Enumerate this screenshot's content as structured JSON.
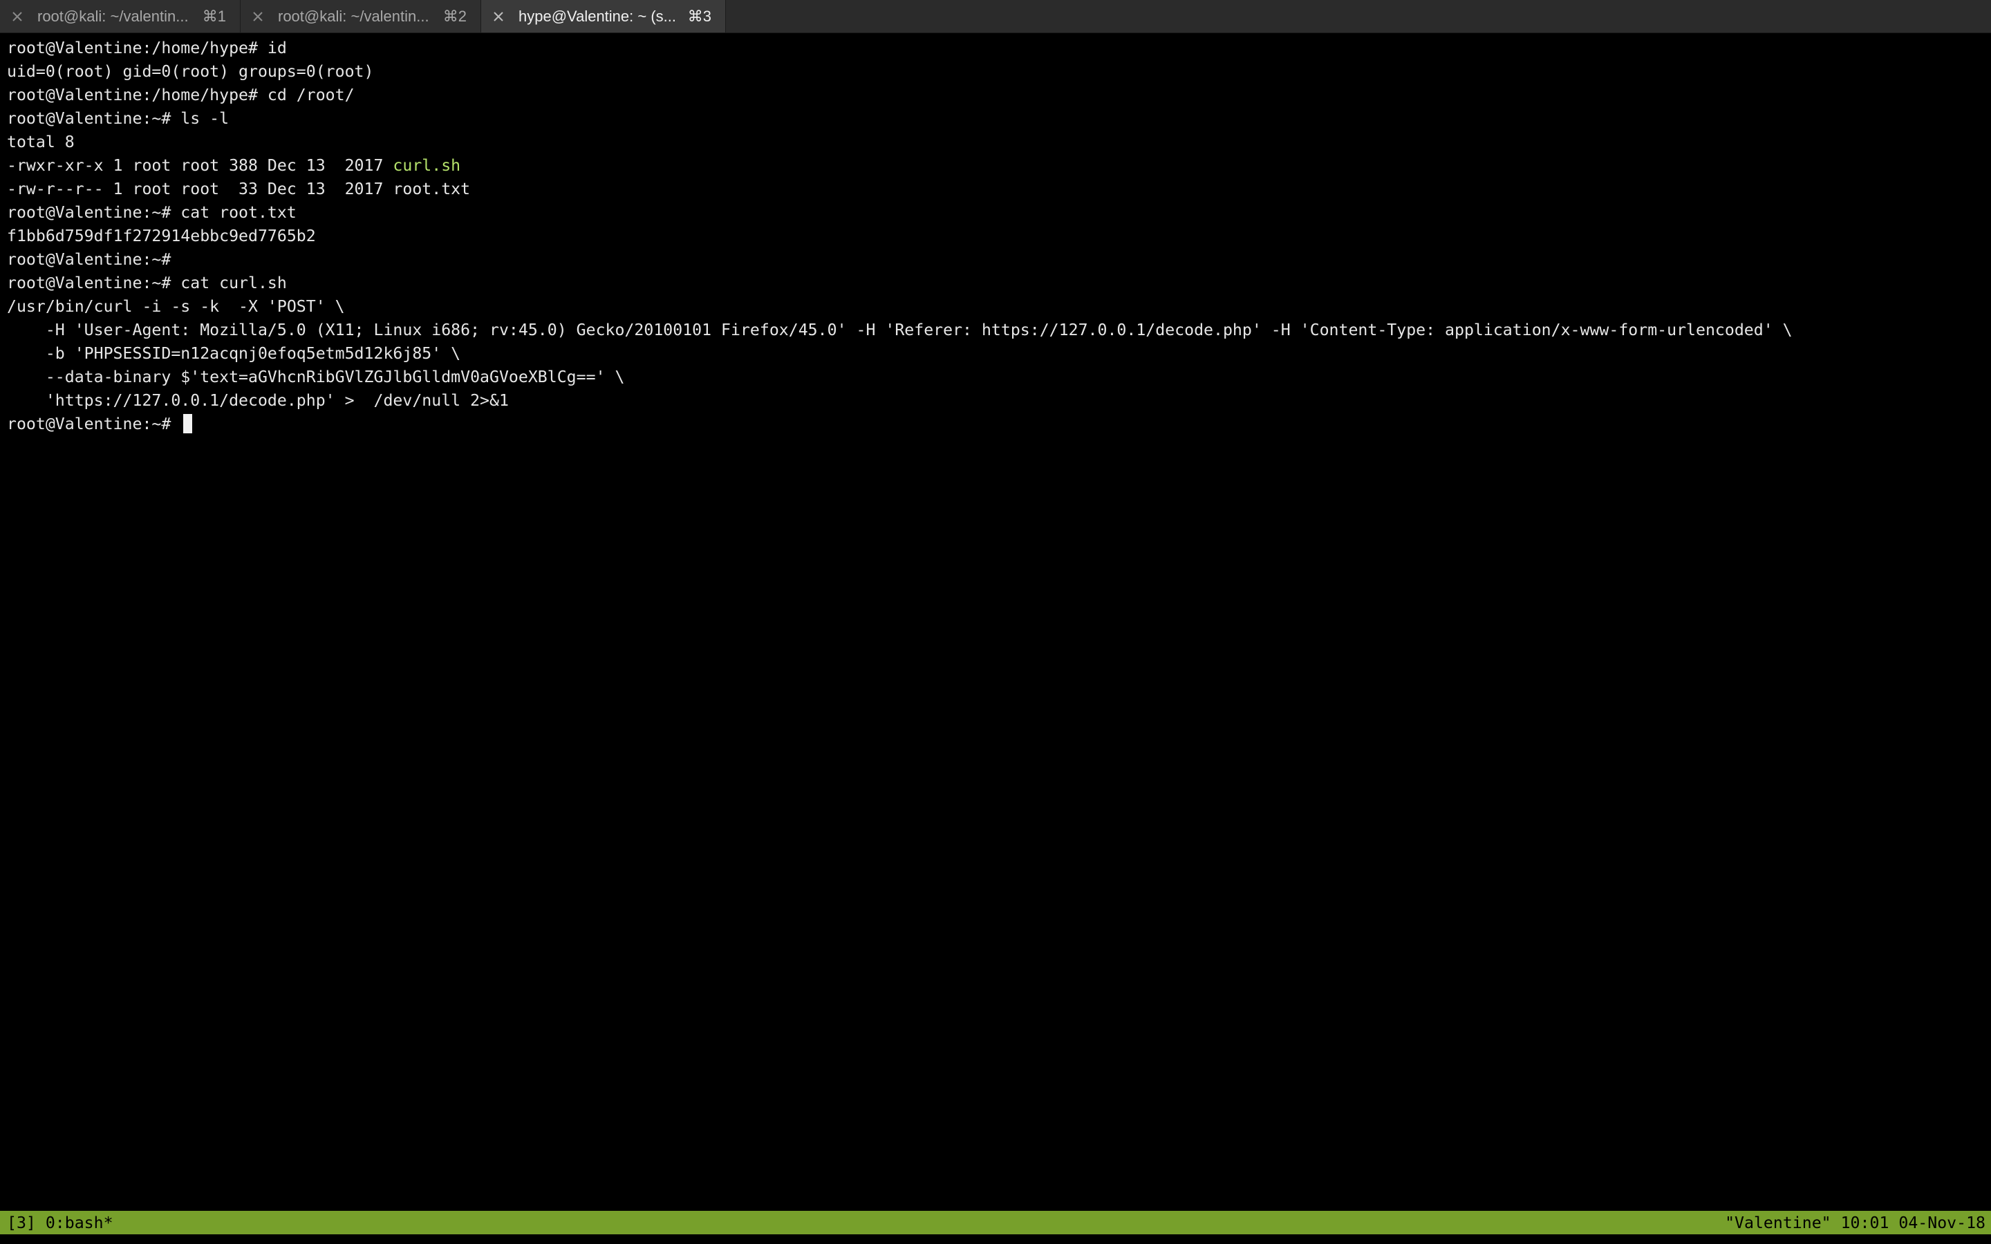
{
  "tabs": [
    {
      "label": "root@kali: ~/valentin...",
      "shortcut": "⌘1",
      "active": false
    },
    {
      "label": "root@kali: ~/valentin...",
      "shortcut": "⌘2",
      "active": false
    },
    {
      "label": "hype@Valentine: ~ (s...",
      "shortcut": "⌘3",
      "active": true
    }
  ],
  "terminal": {
    "lines": [
      "root@Valentine:/home/hype# id",
      "uid=0(root) gid=0(root) groups=0(root)",
      "root@Valentine:/home/hype# cd /root/",
      "root@Valentine:~# ls -l",
      "total 8",
      "-rwxr-xr-x 1 root root 388 Dec 13  2017 ",
      "curl.sh",
      "-rw-r--r-- 1 root root  33 Dec 13  2017 root.txt",
      "root@Valentine:~# cat root.txt",
      "f1bb6d759df1f272914ebbc9ed7765b2",
      "root@Valentine:~#",
      "root@Valentine:~# cat curl.sh",
      "/usr/bin/curl -i -s -k  -X 'POST' \\",
      "    -H 'User-Agent: Mozilla/5.0 (X11; Linux i686; rv:45.0) Gecko/20100101 Firefox/45.0' -H 'Referer: https://127.0.0.1/decode.php' -H 'Content-Type: application/x-www-form-urlencoded' \\",
      "    -b 'PHPSESSID=n12acqnj0efoq5etm5d12k6j85' \\",
      "    --data-binary $'text=aGVhcnRibGVlZGJlbGlldmV0aGVoeXBlCg==' \\",
      "    'https://127.0.0.1/decode.php' >  /dev/null 2>&1",
      "root@Valentine:~# "
    ]
  },
  "status": {
    "left": "[3] 0:bash*",
    "right": "\"Valentine\" 10:01 04-Nov-18"
  },
  "colors": {
    "background": "#000000",
    "text": "#e6e6e6",
    "executable": "#b5e26b",
    "status_bar": "#77a02b"
  }
}
